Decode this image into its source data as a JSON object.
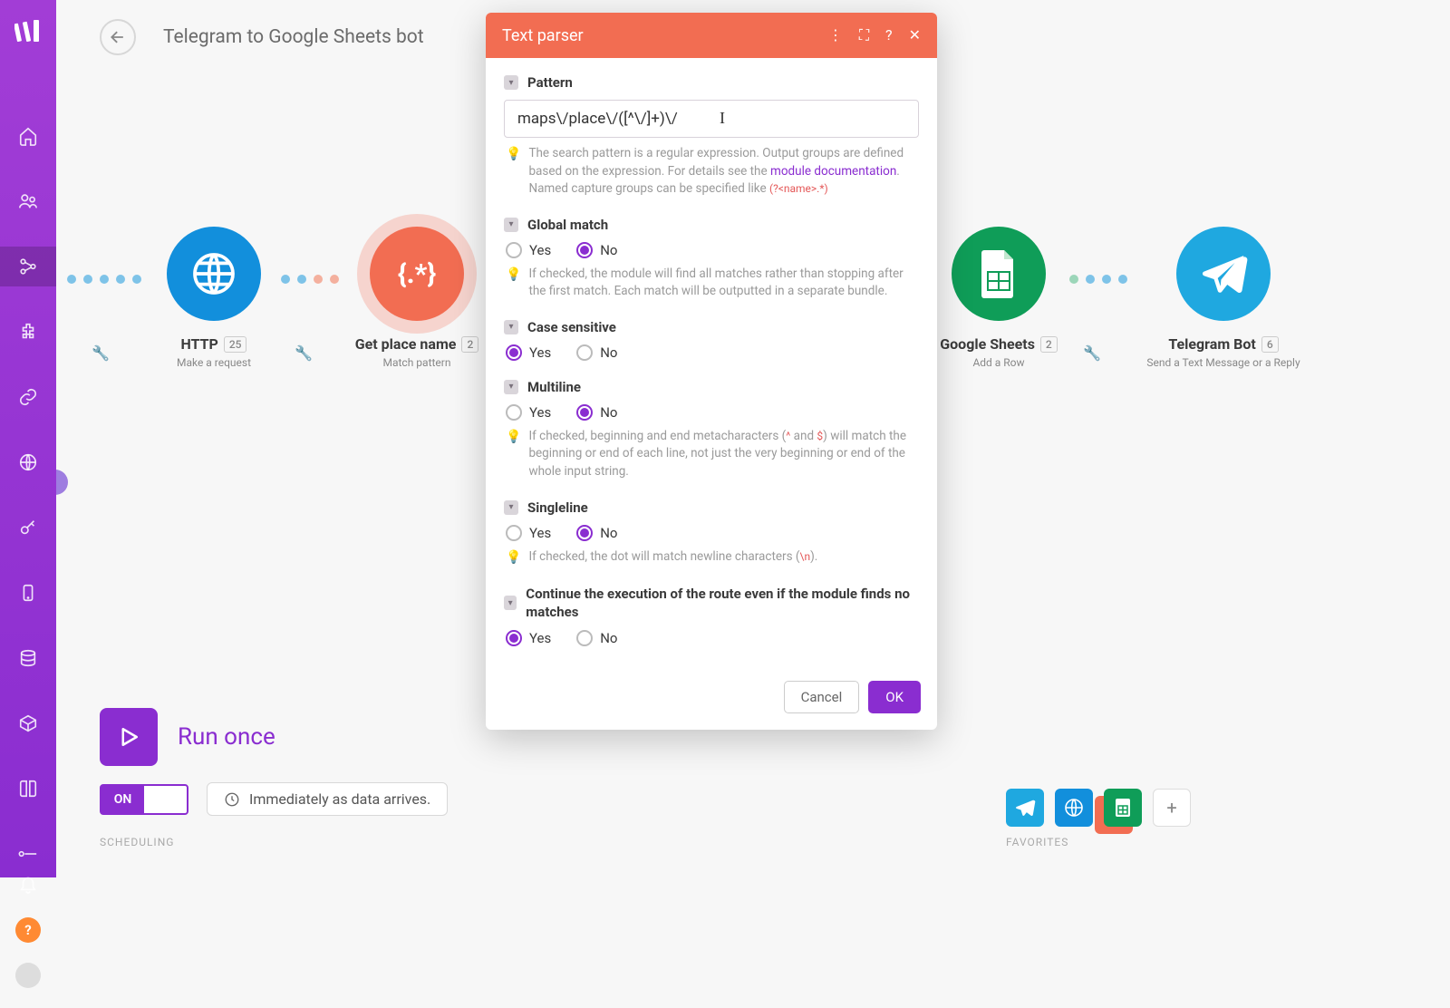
{
  "scenario_title": "Telegram to Google Sheets bot",
  "nodes": {
    "http": {
      "title": "HTTP",
      "sub": "Make a request",
      "badge": "25"
    },
    "parser": {
      "title": "Get place name",
      "sub": "Match pattern",
      "badge": "2"
    },
    "sheets": {
      "title": "Google Sheets",
      "sub": "Add a Row",
      "badge": "2"
    },
    "telegram": {
      "title": "Telegram Bot",
      "sub": "Send a Text Message or a Reply",
      "badge": "6"
    }
  },
  "dialog": {
    "title": "Text parser",
    "pattern_label": "Pattern",
    "pattern_value": "maps\\/place\\/([^\\/]+)\\/",
    "pattern_hint_a": "The search pattern is a regular expression. Output groups are defined based on the expression. For details see the ",
    "pattern_hint_link": "module documentation",
    "pattern_hint_b": ".",
    "pattern_hint_c": "Named capture groups can be specified like ",
    "pattern_hint_code": "(?<name>.*)",
    "global_label": "Global match",
    "global_hint": "If checked, the module will find all matches rather than stopping after the first match. Each match will be outputted in a separate bundle.",
    "case_label": "Case sensitive",
    "multiline_label": "Multiline",
    "multiline_hint_a": "If checked, beginning and end metacharacters (",
    "multiline_caret": "^",
    "multiline_hint_b": " and ",
    "multiline_dollar": "$",
    "multiline_hint_c": ") will match the beginning or end of each line, not just the very beginning or end of the whole input string.",
    "singleline_label": "Singleline",
    "singleline_hint_a": "If checked, the dot will match newline characters (",
    "singleline_code": "\\n",
    "singleline_hint_b": ").",
    "continue_label": "Continue the execution of the route even if the module finds no matches",
    "yes": "Yes",
    "no": "No",
    "cancel": "Cancel",
    "ok": "OK"
  },
  "run_once": "Run once",
  "toggle_on": "ON",
  "schedule_text": "Immediately as data arrives.",
  "scheduling_label": "SCHEDULING",
  "favorites_label": "FAVORITES"
}
